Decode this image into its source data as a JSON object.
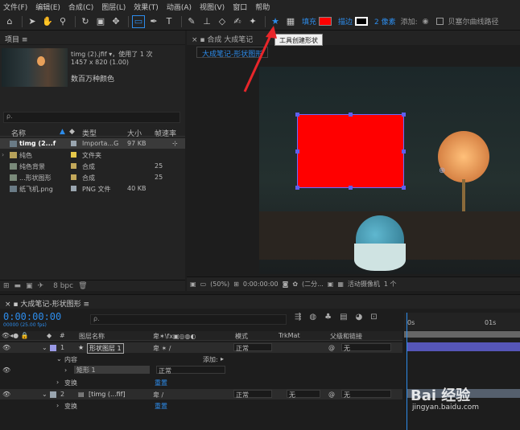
{
  "menu": [
    "文件(F)",
    "编辑(E)",
    "合成(C)",
    "图层(L)",
    "效果(T)",
    "动画(A)",
    "视图(V)",
    "窗口",
    "帮助"
  ],
  "toolbar": {
    "fill_label": "填充",
    "stroke_label": "描边",
    "stroke_width": "2 像素",
    "add_label": "添加:",
    "bezier_label": "贝塞尔曲线路径"
  },
  "tooltip": "工具创建形状",
  "project": {
    "tab_label": "项目 ≡",
    "file_name": "timg (2).jfif ▾，使用了 1 次",
    "file_size": "1457 x 820 (1.00)",
    "file_colors": "数百万种颜色",
    "search_placeholder": "ρ.",
    "columns": {
      "name": "名称",
      "type": "类型",
      "size": "大小",
      "rate": "帧速率"
    },
    "items": [
      {
        "name": "timg (2...f",
        "type": "Importa...G",
        "size": "97 KB",
        "color": "#9aa6b0"
      },
      {
        "name": "纯色",
        "type": "文件夹",
        "size": "",
        "color": "#e6c84a"
      },
      {
        "name": "纯色背景",
        "type": "合成",
        "size": "25",
        "color": "#c3a85a"
      },
      {
        "name": "...形状图形",
        "type": "合成",
        "size": "25",
        "color": "#c3a85a"
      },
      {
        "name": "纸飞机.png",
        "type": "PNG 文件",
        "size": "40 KB",
        "color": "#9aa6b0"
      }
    ],
    "bpc": "8 bpc"
  },
  "viewer": {
    "tab_label": "合成 大成笔记",
    "breadcrumb": "大成笔记-形状图形",
    "zoom": "(50%)",
    "timecode": "0:00:00:00",
    "resolution": "(二分...",
    "camera": "活动摄像机",
    "view": "1 个"
  },
  "timeline": {
    "tab_label": "大成笔记-形状图形 ≡",
    "timecode": "0:00:00:00",
    "timecode_sub": "00000 (25.00 fps)",
    "search_placeholder": "ρ.",
    "columns": {
      "layer_name": "图层名称",
      "mode": "模式",
      "trkmat": "TrkMat",
      "parent": "父级和链接"
    },
    "layers": [
      {
        "num": "1",
        "name": "形状图层 1",
        "mode": "正常",
        "parent": "无"
      },
      {
        "num": "2",
        "name": "[timg (...fif]",
        "mode": "正常",
        "trkmat": "无",
        "parent": "无"
      }
    ],
    "content_label": "内容",
    "add_label": "添加:",
    "rect_label": "矩形 1",
    "rect_mode": "正常",
    "transform_label": "变换",
    "reset_label": "重置",
    "ruler_start": "0s",
    "ruler_1s": "01s"
  },
  "watermark": {
    "brand": "Bai 经验",
    "url": "jingyan.baidu.com"
  }
}
